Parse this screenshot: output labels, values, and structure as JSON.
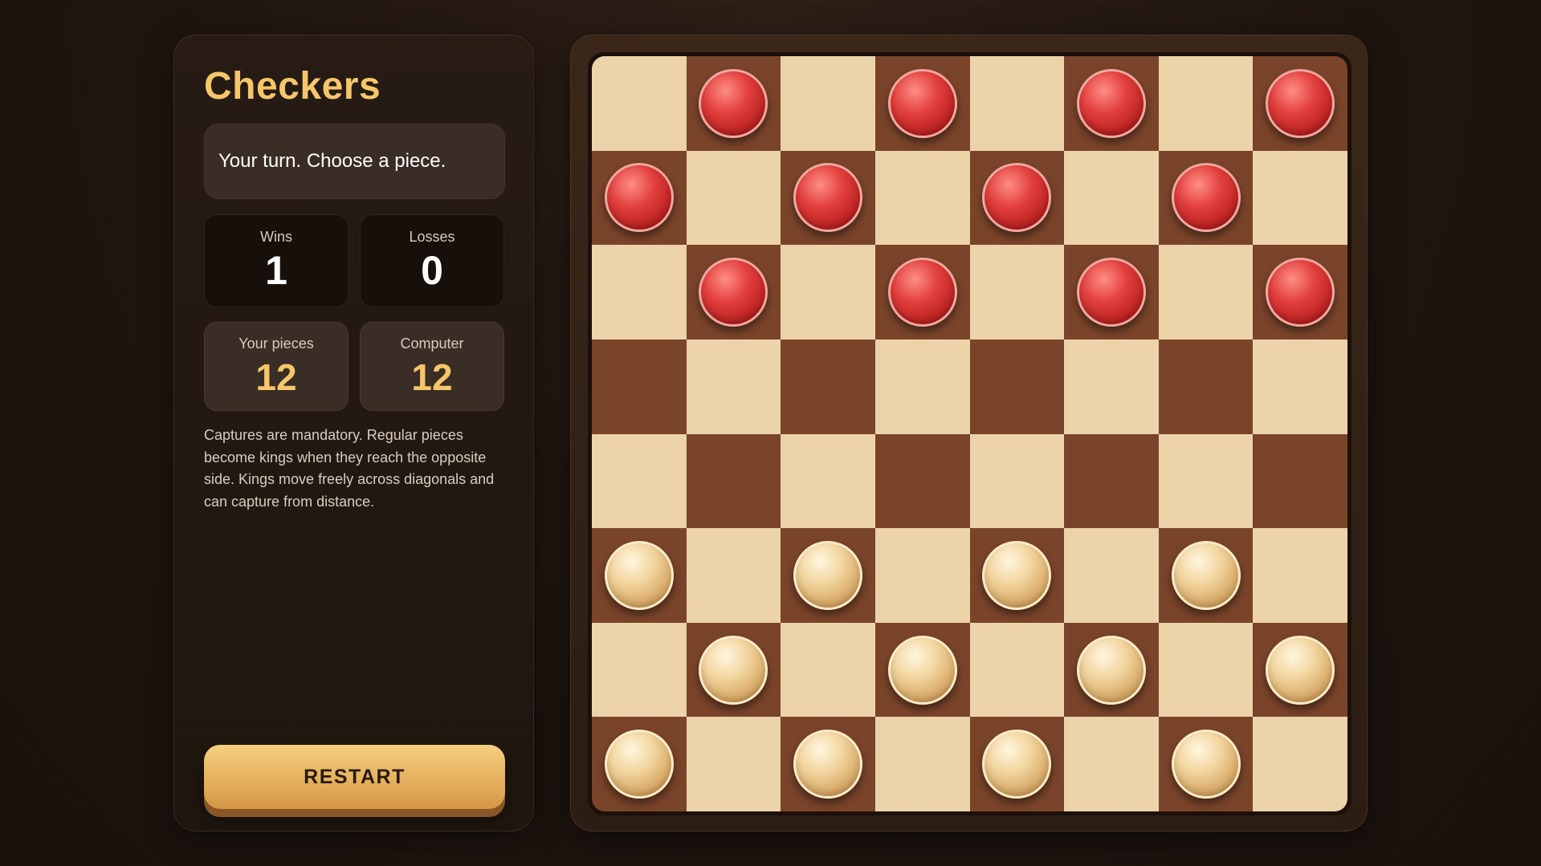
{
  "game": {
    "title": "Checkers",
    "status": "Your turn. Choose a piece.",
    "rules": "Captures are mandatory. Regular pieces become kings when they reach the opposite side. Kings move freely across diagonals and can capture from distance.",
    "restart_label": "RESTART"
  },
  "stats": {
    "wins_label": "Wins",
    "wins": "1",
    "losses_label": "Losses",
    "losses": "0",
    "your_pieces_label": "Your pieces",
    "your_pieces": "12",
    "computer_label": "Computer",
    "computer_pieces": "12"
  },
  "board": {
    "size": 8,
    "rows": [
      ".r.r.r.r",
      "r.r.r.r.",
      ".r.r.r.r",
      "........",
      "........",
      "c.c.c.c.",
      ".c.c.c.c",
      "c.c.c.c."
    ],
    "legend": {
      "r": "computer-red",
      "c": "player-cream",
      ".": "empty"
    }
  },
  "colors": {
    "accent": "#f6c66b",
    "light_square": "#ecd3a9",
    "dark_square": "#7a442a",
    "computer_piece": "#d83a37",
    "player_piece": "#e9c889"
  }
}
